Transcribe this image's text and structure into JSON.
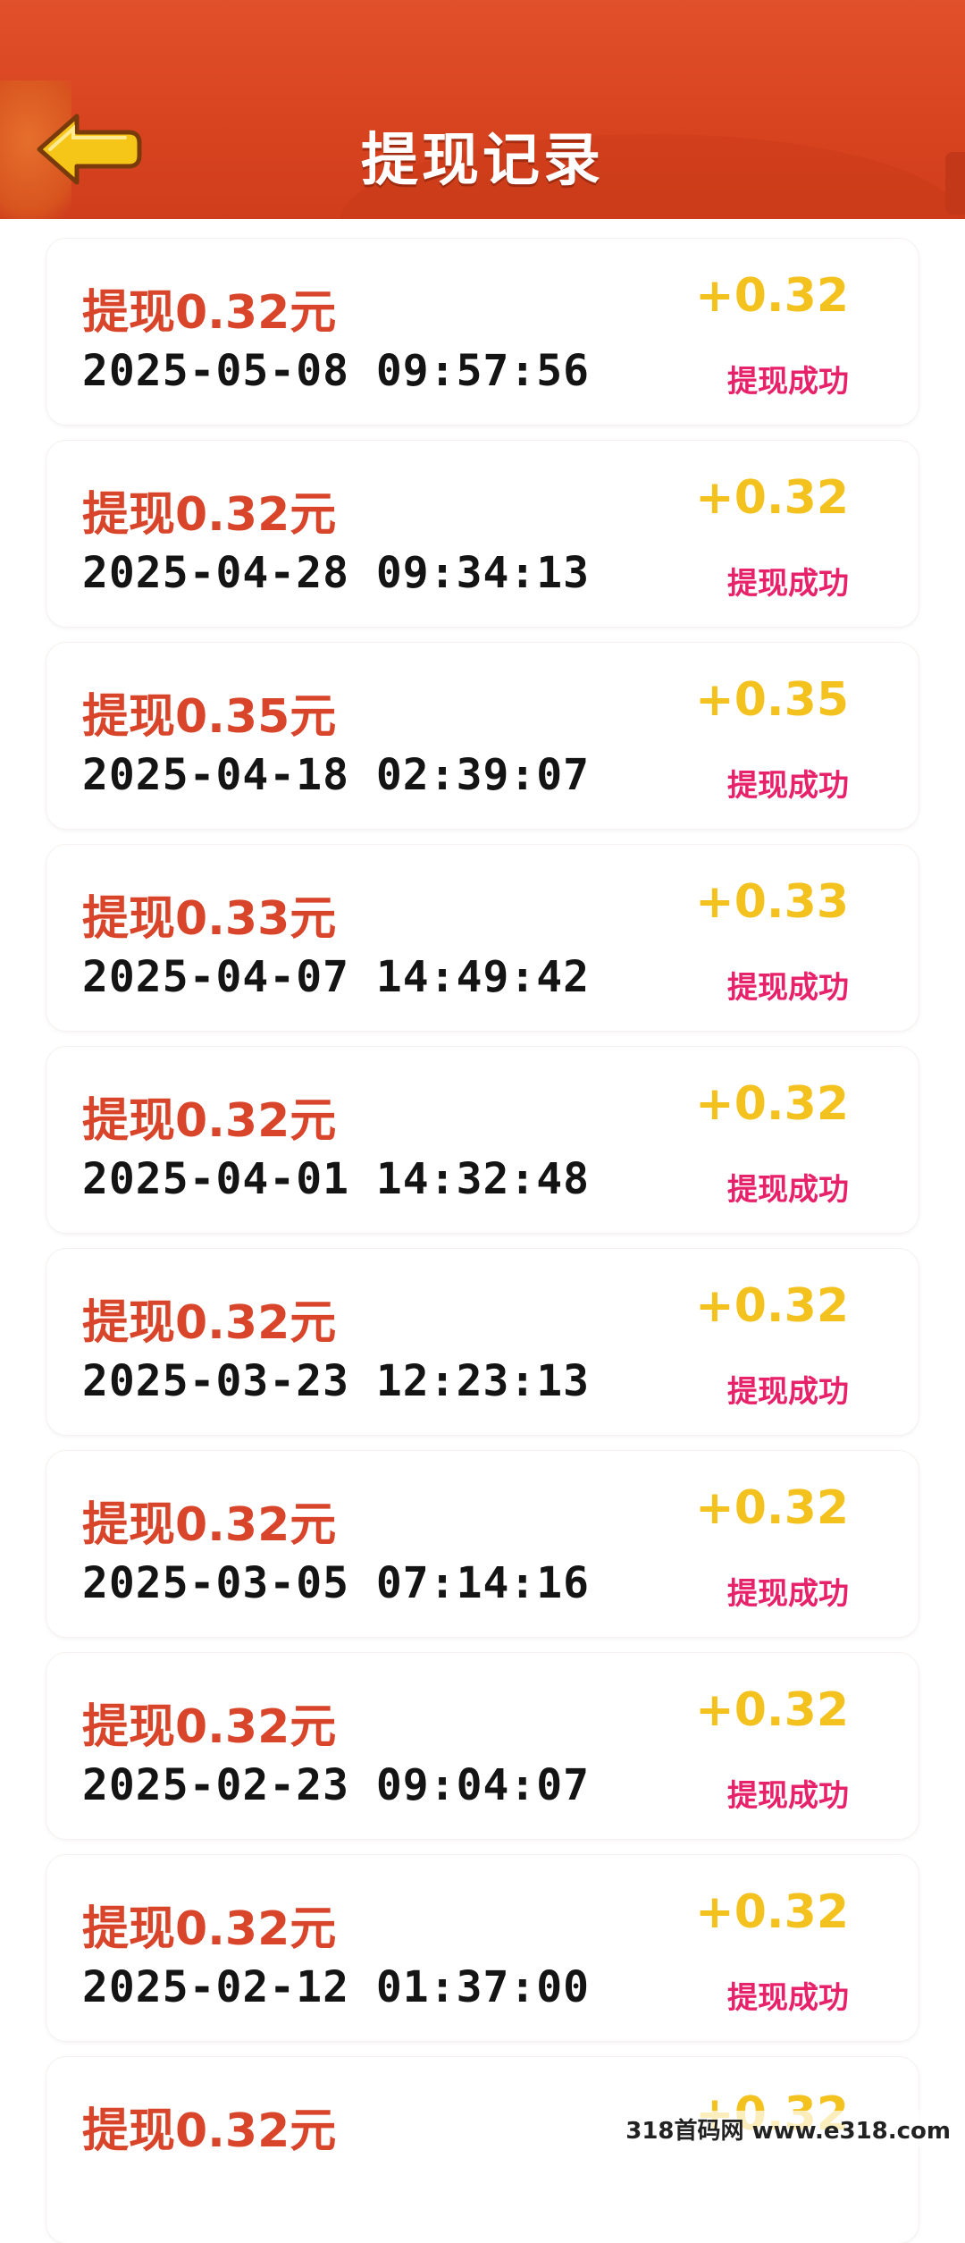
{
  "header": {
    "title": "提现记录",
    "back_icon": "back-arrow-icon",
    "colors": {
      "background": "#d8431f",
      "title": "#ffffff",
      "back_arrow": "#f5c518"
    }
  },
  "records": [
    {
      "title": "提现0.32元",
      "datetime": "2025-05-08 09:57:56",
      "amount": "+0.32",
      "status": "提现成功"
    },
    {
      "title": "提现0.32元",
      "datetime": "2025-04-28 09:34:13",
      "amount": "+0.32",
      "status": "提现成功"
    },
    {
      "title": "提现0.35元",
      "datetime": "2025-04-18 02:39:07",
      "amount": "+0.35",
      "status": "提现成功"
    },
    {
      "title": "提现0.33元",
      "datetime": "2025-04-07 14:49:42",
      "amount": "+0.33",
      "status": "提现成功"
    },
    {
      "title": "提现0.32元",
      "datetime": "2025-04-01 14:32:48",
      "amount": "+0.32",
      "status": "提现成功"
    },
    {
      "title": "提现0.32元",
      "datetime": "2025-03-23 12:23:13",
      "amount": "+0.32",
      "status": "提现成功"
    },
    {
      "title": "提现0.32元",
      "datetime": "2025-03-05 07:14:16",
      "amount": "+0.32",
      "status": "提现成功"
    },
    {
      "title": "提现0.32元",
      "datetime": "2025-02-23 09:04:07",
      "amount": "+0.32",
      "status": "提现成功"
    },
    {
      "title": "提现0.32元",
      "datetime": "2025-02-12 01:37:00",
      "amount": "+0.32",
      "status": "提现成功"
    },
    {
      "title": "提现0.32元",
      "datetime": "",
      "amount": "+0.32",
      "status": ""
    }
  ],
  "colors": {
    "amount_title": "#d8452a",
    "plus_amount": "#f4c21f",
    "status": "#e8226a",
    "datetime": "#141414"
  },
  "watermark": "318首码网 www.e318.com"
}
